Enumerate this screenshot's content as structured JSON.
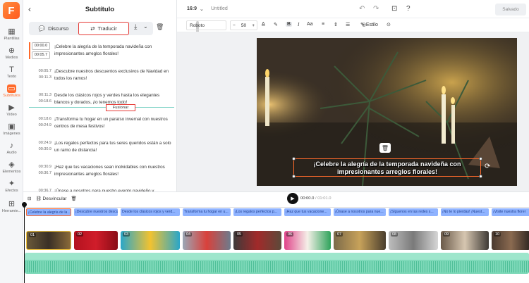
{
  "app": {
    "logo": "F"
  },
  "rail": [
    {
      "icon": "▦",
      "label": "Plantillas"
    },
    {
      "icon": "⊕",
      "label": "Medios"
    },
    {
      "icon": "T",
      "label": "Texto"
    },
    {
      "icon": "▭",
      "label": "Subtítulos",
      "active": true
    },
    {
      "icon": "▶",
      "label": "Vídeo"
    },
    {
      "icon": "▣",
      "label": "Imágenes"
    },
    {
      "icon": "♪",
      "label": "Audio"
    },
    {
      "icon": "◈",
      "label": "Elementos"
    },
    {
      "icon": "✦",
      "label": "Efectos"
    },
    {
      "icon": "⊞",
      "label": "Herramie..."
    }
  ],
  "panel": {
    "back": "‹",
    "title": "Subtítulo",
    "tab_discurso": "Discurso",
    "tab_traducir": "Traducir",
    "download_icon": "⤓",
    "chevron": "⌄",
    "trash": "🗑",
    "fusion_label": "Fusionar",
    "rows": [
      {
        "start": "00:00.0",
        "end": "00:05.7",
        "text": "¡Celebre la alegría de la temporada navideña con impresionantes arreglos florales!",
        "boxed": true
      },
      {
        "start": "00:05.7",
        "end": "00:11.3",
        "text": "¡Descubre nuestros descuentos exclusivos de Navidad en todos los ramos!"
      },
      {
        "start": "00:11.3",
        "end": "00:18.6",
        "text": "Desde los clásicos rojos y verdes hasta los elegantes blancos y dorados, ¡lo tenemos todo!"
      },
      {
        "start": "00:18.6",
        "end": "00:24.9",
        "text": "¡Transforma tu hogar en un paraíso invernal con nuestros centros de mesa festivos!"
      },
      {
        "start": "00:24.9",
        "end": "00:30.9",
        "text": "¡Los regalos perfectos para tus seres queridos están a solo un ramo de distancia!"
      },
      {
        "start": "00:30.9",
        "end": "00:36.7",
        "text": "¡Haz que tus vacaciones sean inolvidables con nuestros impresionantes arreglos florales!"
      },
      {
        "start": "00:36.7",
        "end": "",
        "text": "¡Únase a nosotros para nuestro evento navideño y"
      }
    ]
  },
  "topbar": {
    "ratio": "16:9",
    "ratio_chevron": "⌄",
    "doc_title": "Untitled",
    "save_label": "Salvado"
  },
  "format": {
    "font": "Roboto",
    "size": "50",
    "minus": "−",
    "plus": "+",
    "style_label": "Estilo"
  },
  "caption": {
    "line1": "¡Celebre la alegría de la temporada navideña con",
    "line2": "impresionantes arreglos florales!"
  },
  "timeline": {
    "current": "00:00.0",
    "total": "/ 01:01.0",
    "unlink_label": "Desvincular",
    "subs": [
      "¡Celebre la alegría de la ...",
      "¡Descubre nuestros descue...",
      "Desde los clásicos rojos y verd...",
      "Transforma tu hogar en u...",
      "¡Los regalos perfectos p...",
      "¡Haz que tus vacacione...",
      "¡Únase a nosotros para nue...",
      "¡Síguenos en las redes s...",
      "¡No te lo pierdas! ¡Nuest...",
      "¡Visite nuestra florer"
    ],
    "clip_numbers": [
      "01",
      "02",
      "03",
      "04",
      "05",
      "06",
      "07",
      "08",
      "09",
      "10"
    ]
  },
  "colors": {
    "accent": "#ff6a2b",
    "highlight": "#e53935",
    "subtitle_track": "#8fb3ff",
    "audio_track": "#7ed9b9"
  }
}
